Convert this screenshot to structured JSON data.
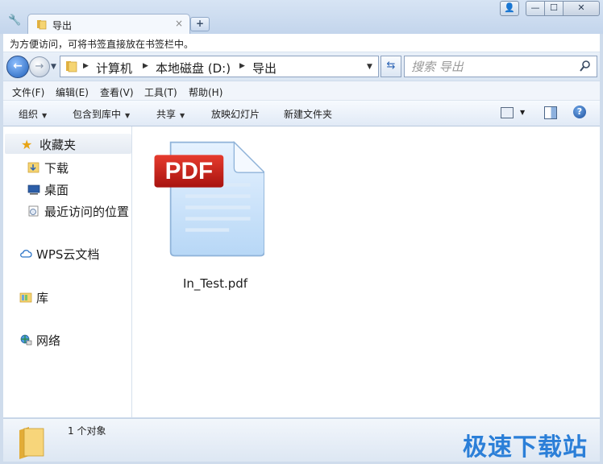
{
  "title_bar": {
    "tab_title": "导出",
    "tab_close": "×",
    "new_tab": "+",
    "window_buttons": {
      "user": "👤",
      "minimize": "—",
      "maximize": "☐",
      "close": "✕"
    }
  },
  "hint_bar": {
    "text": "为方便访问，可将书签直接放在书签栏中。"
  },
  "address": {
    "crumbs": [
      "计算机",
      "本地磁盘 (D:)",
      "导出"
    ],
    "search_placeholder": "搜索 导出"
  },
  "menu": [
    "文件(F)",
    "编辑(E)",
    "查看(V)",
    "工具(T)",
    "帮助(H)"
  ],
  "toolbar": {
    "organize": "组织",
    "include_library": "包含到库中",
    "share": "共享",
    "slideshow": "放映幻灯片",
    "new_folder": "新建文件夹"
  },
  "nav": {
    "favorites": "收藏夹",
    "downloads": "下载",
    "desktop": "桌面",
    "recent": "最近访问的位置",
    "wps": "WPS云文档",
    "library": "库",
    "network": "网络"
  },
  "file": {
    "name": "In_Test.pdf",
    "badge": "PDF",
    "icon": "pdf-file-icon"
  },
  "status": {
    "text": "1 个对象"
  },
  "watermark": "极速下载站",
  "colors": {
    "accent": "#2b7fd8",
    "pdf_red": "#c8201c"
  }
}
